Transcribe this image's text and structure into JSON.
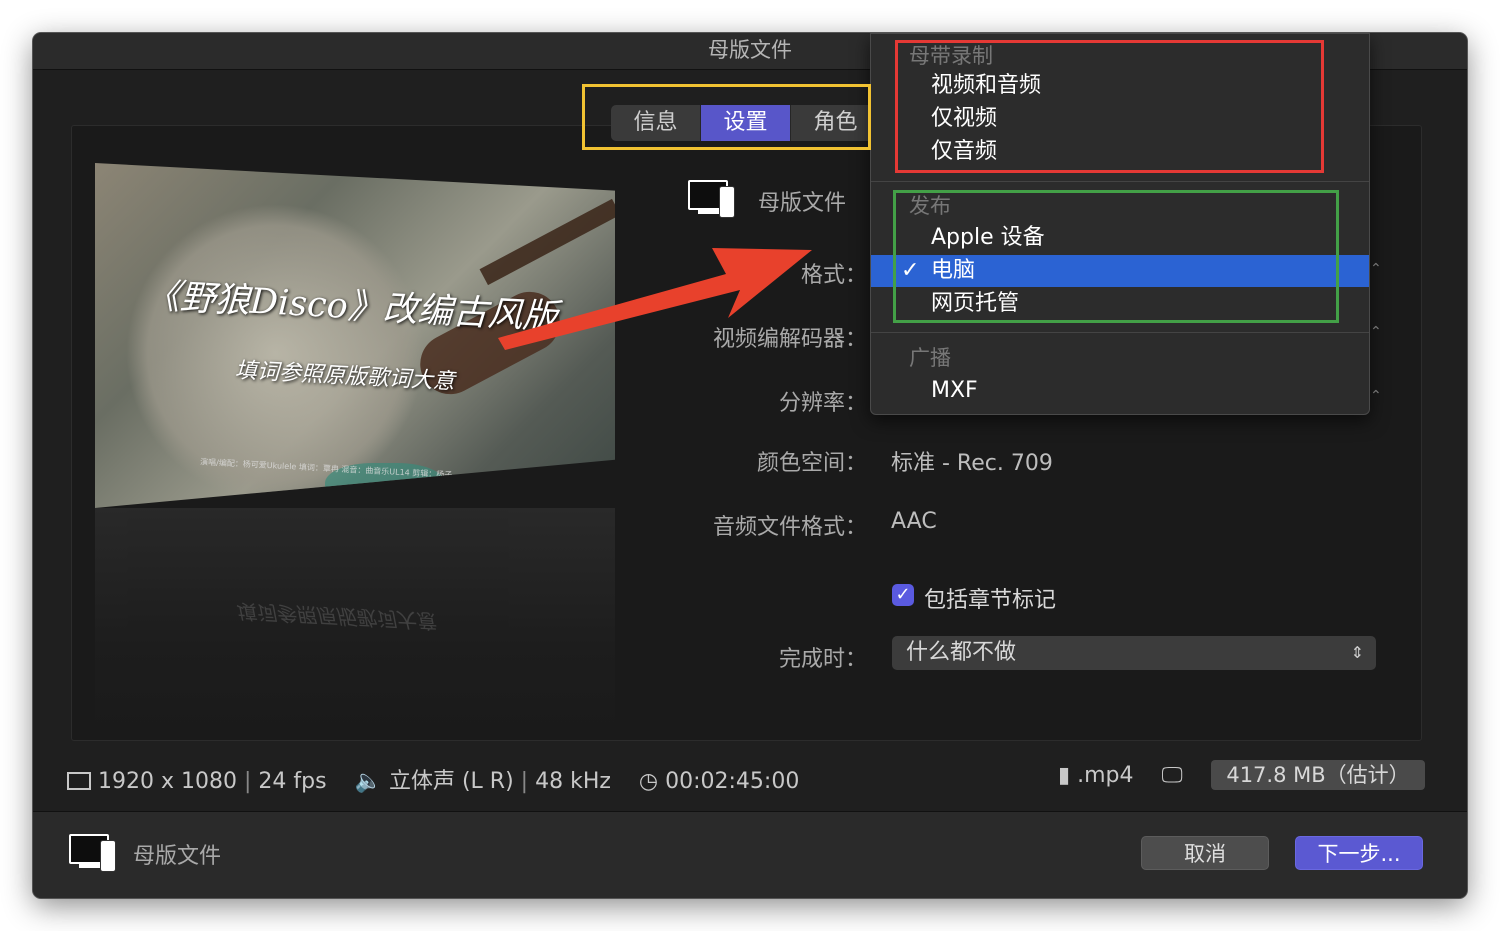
{
  "window": {
    "title": "母版文件"
  },
  "tabs": [
    {
      "label": "信息",
      "active": false
    },
    {
      "label": "设置",
      "active": true
    },
    {
      "label": "角色",
      "active": false
    }
  ],
  "preview": {
    "title": "《野狼Disco》改编古风版",
    "subtitle": "填词参照原版歌词大意",
    "credits": "演唱/编配：杨可爱Ukulele    填词：覃冉    混音：曲音乐UL14    剪辑：杨子"
  },
  "settings": {
    "destination_name": "母版文件",
    "format_label": "格式：",
    "codec_label": "视频编解码器：",
    "resolution_label": "分辨率：",
    "colorspace_label": "颜色空间：",
    "colorspace_value": "标准 - Rec. 709",
    "audio_format_label": "音频文件格式：",
    "audio_format_value": "AAC",
    "chapters_checkbox_label": "包括章节标记",
    "chapters_checked": true,
    "on_complete_label": "完成时：",
    "on_complete_value": "什么都不做"
  },
  "menu": {
    "sections": [
      {
        "header": "母带录制",
        "items": [
          "视频和音频",
          "仅视频",
          "仅音频"
        ]
      },
      {
        "header": "发布",
        "items": [
          "Apple 设备",
          "电脑",
          "网页托管"
        ],
        "selected": "电脑"
      },
      {
        "header": "广播",
        "items": [
          "MXF"
        ]
      }
    ]
  },
  "info": {
    "resolution": "1920 x 1080",
    "fps": "24 fps",
    "audio": "立体声 (L R)",
    "sample_rate": "48 kHz",
    "duration": "00:02:45:00",
    "extension": ".mp4",
    "size": "417.8 MB（估计）"
  },
  "footer": {
    "title": "母版文件",
    "cancel_label": "取消",
    "next_label": "下一步..."
  },
  "colors": {
    "accent": "#5856c9",
    "selection": "#2b63d3",
    "annotation_yellow": "#f1c232",
    "annotation_red": "#e53935",
    "annotation_green": "#43a047",
    "arrow": "#e8412c"
  }
}
